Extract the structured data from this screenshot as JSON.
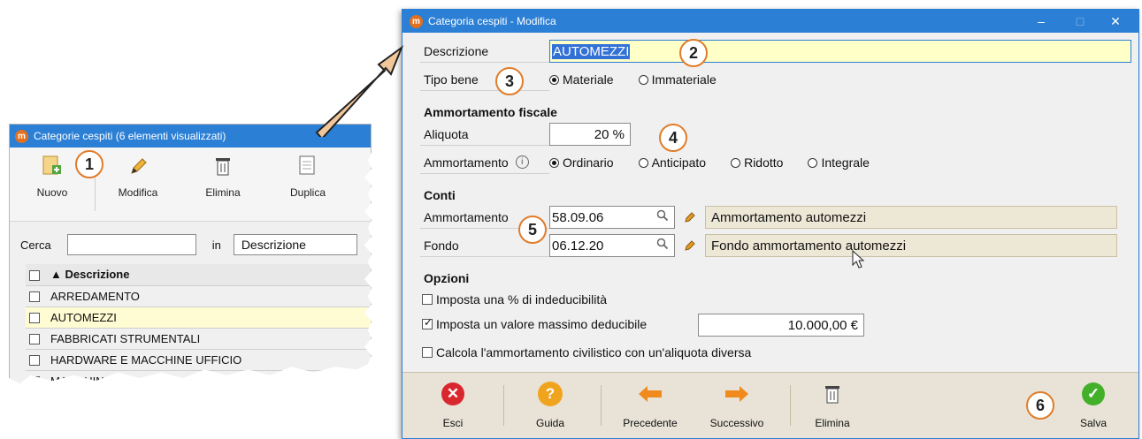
{
  "list_window": {
    "title": "Categorie cespiti (6 elementi visualizzati)",
    "app_icon_letter": "m",
    "toolbar": [
      "Nuovo",
      "Modifica",
      "Elimina",
      "Duplica"
    ],
    "search_label": "Cerca",
    "search_value": "",
    "in_label": "in",
    "search_field": "Descrizione",
    "column_header": "▲ Descrizione",
    "rows": [
      "ARREDAMENTO",
      "AUTOMEZZI",
      "FABBRICATI STRUMENTALI",
      "HARDWARE E MACCHINE UFFICIO",
      "MACCHINARI"
    ],
    "selected_row": "AUTOMEZZI"
  },
  "edit_window": {
    "title": "Categoria cespiti - Modifica",
    "app_icon_letter": "m",
    "descrizione_label": "Descrizione",
    "descrizione_value": "AUTOMEZZI",
    "tipo_bene_label": "Tipo bene",
    "tipo_bene_options": [
      "Materiale",
      "Immateriale"
    ],
    "tipo_bene_selected": "Materiale",
    "section_fiscale": "Ammortamento fiscale",
    "aliquota_label": "Aliquota",
    "aliquota_value": "20 %",
    "ammortamento_label": "Ammortamento",
    "info_symbol": "i",
    "ammortamento_options": [
      "Ordinario",
      "Anticipato",
      "Ridotto",
      "Integrale"
    ],
    "ammortamento_selected": "Ordinario",
    "section_conti": "Conti",
    "conto_ammortamento_label": "Ammortamento",
    "conto_ammortamento_code": "58.09.06",
    "conto_ammortamento_desc": "Ammortamento automezzi",
    "conto_fondo_label": "Fondo",
    "conto_fondo_code": "06.12.20",
    "conto_fondo_desc": "Fondo ammortamento automezzi",
    "section_opzioni": "Opzioni",
    "opt_indeducibilita": "Imposta una % di indeducibilità",
    "opt_indeducibilita_checked": false,
    "opt_valore_massimo": "Imposta un valore massimo deducibile",
    "opt_valore_massimo_checked": true,
    "valore_massimo_value": "10.000,00 €",
    "opt_civilistico": "Calcola l'ammortamento civilistico con un'aliquota diversa",
    "opt_civilistico_checked": false,
    "bottom_toolbar": [
      "Esci",
      "Guida",
      "Precedente",
      "Successivo",
      "Elimina",
      "Salva"
    ],
    "window_controls": [
      "–",
      "□",
      "✕"
    ]
  },
  "badges": [
    "1",
    "2",
    "3",
    "4",
    "5",
    "6"
  ],
  "colors": {
    "titlebar": "#2b7fd4",
    "badge_border": "#e07c2a",
    "selected_row": "#fffbd2",
    "highlight_input": "#ffffc8",
    "esci": "#d9272e",
    "guida": "#f0a41e",
    "arrow_orange": "#f08a1c",
    "salva": "#43b02a"
  },
  "icons": {
    "nuovo": "new-document-icon",
    "modifica": "pencil-icon",
    "elimina": "trash-icon",
    "duplica": "duplicate-icon",
    "search": "magnifier-icon",
    "esci": "close-circle-icon",
    "guida": "help-icon",
    "precedente": "arrow-left-icon",
    "successivo": "arrow-right-icon",
    "salva": "check-circle-icon"
  }
}
